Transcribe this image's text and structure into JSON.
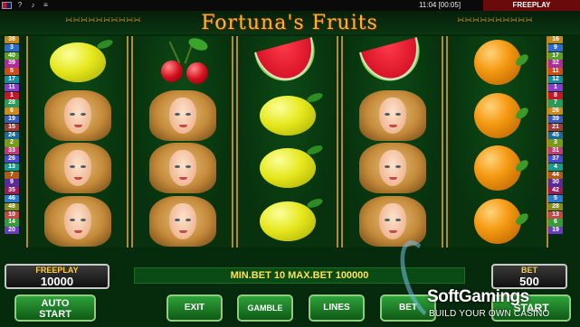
{
  "topbar": {
    "flag_icon": "uk-flag-icon",
    "help": "?",
    "sound": "♪",
    "menu": "≡",
    "clock": "11:04 [00:05]",
    "mode": "FREEPLAY"
  },
  "game": {
    "title": "Fortuna's Fruits"
  },
  "paylines": {
    "left": [
      "38",
      "3",
      "40",
      "39",
      "5",
      "17",
      "11",
      "1",
      "28",
      "6",
      "19",
      "15",
      "24",
      "2",
      "33",
      "26",
      "13",
      "7",
      "9",
      "35",
      "46",
      "48",
      "10",
      "14",
      "20"
    ],
    "right": [
      "16",
      "9",
      "17",
      "32",
      "11",
      "12",
      "1",
      "8",
      "7",
      "26",
      "39",
      "21",
      "45",
      "3",
      "31",
      "37",
      "4",
      "44",
      "30",
      "42",
      "5",
      "28",
      "13",
      "6",
      "19"
    ],
    "colors": [
      "#c28a1a",
      "#2e6bd0",
      "#5a9e2a",
      "#b02a9a",
      "#d04a1a",
      "#1a8aa0",
      "#8a3ad0",
      "#c01a2a",
      "#2a9a5a",
      "#d08a1a",
      "#3a5ac0",
      "#a03a3a",
      "#1a6a9a",
      "#7a9a1a",
      "#c03a7a",
      "#4a4ad0",
      "#1a9a8a",
      "#b05a1a",
      "#5a2a9a",
      "#9a1a5a",
      "#2a7ad0",
      "#8a8a1a",
      "#c04a4a",
      "#3a9a3a",
      "#6a3ac0"
    ]
  },
  "reels": [
    [
      "lemon",
      "lady",
      "lady",
      "lady"
    ],
    [
      "cherry",
      "lady",
      "lady",
      "lady"
    ],
    [
      "watermelon",
      "lemon",
      "lemon",
      "lemon"
    ],
    [
      "watermelon",
      "lady",
      "lady",
      "lady"
    ],
    [
      "orange",
      "orange",
      "orange",
      "orange"
    ]
  ],
  "panel": {
    "freeplay_label": "FREEPLAY",
    "freeplay_value": "10000",
    "message": "MIN.BET 10 MAX.BET 100000",
    "bet_label": "BET",
    "bet_value": "500"
  },
  "buttons": {
    "auto_line1": "AUTO",
    "auto_line2": "START",
    "exit": "EXIT",
    "gamble": "GAMBLE",
    "lines": "LINES",
    "bet": "BET",
    "start": "START"
  },
  "watermark": {
    "name": "SoftGamings",
    "tagline": "BUILD YOUR OWN CASINO"
  }
}
